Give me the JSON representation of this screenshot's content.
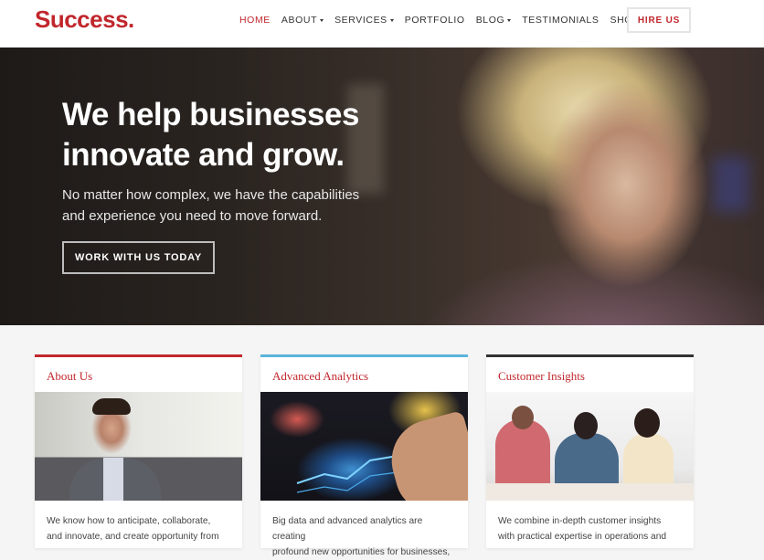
{
  "header": {
    "logo": "Success.",
    "nav": [
      {
        "label": "HOME",
        "active": true,
        "dropdown": false
      },
      {
        "label": "ABOUT",
        "active": false,
        "dropdown": true
      },
      {
        "label": "SERVICES",
        "active": false,
        "dropdown": true
      },
      {
        "label": "PORTFOLIO",
        "active": false,
        "dropdown": false
      },
      {
        "label": "BLOG",
        "active": false,
        "dropdown": true
      },
      {
        "label": "TESTIMONIALS",
        "active": false,
        "dropdown": false
      },
      {
        "label": "SHOP",
        "active": false,
        "dropdown": false
      }
    ],
    "hire_label": "HIRE US",
    "search_icon": "search-icon"
  },
  "hero": {
    "title_line1": "We help businesses",
    "title_line2": "innovate and grow.",
    "subtitle_line1": "No matter how complex, we have the capabilities",
    "subtitle_line2": "and experience you need to move forward.",
    "button_label": "WORK WITH US TODAY"
  },
  "cards": [
    {
      "title": "About Us",
      "accent": "#c1272d",
      "text_line1": "We know how to anticipate, collaborate,",
      "text_line2": "and innovate, and create opportunity from"
    },
    {
      "title": "Advanced Analytics",
      "accent": "#5bb4dc",
      "text_line1": "Big data and advanced analytics are creating",
      "text_line2": "profound new opportunities for businesses,"
    },
    {
      "title": "Customer Insights",
      "accent": "#333333",
      "text_line1": "We combine in-depth customer insights",
      "text_line2": "with practical expertise in operations and"
    }
  ],
  "colors": {
    "brand": "#c1272d",
    "text": "#333333"
  }
}
